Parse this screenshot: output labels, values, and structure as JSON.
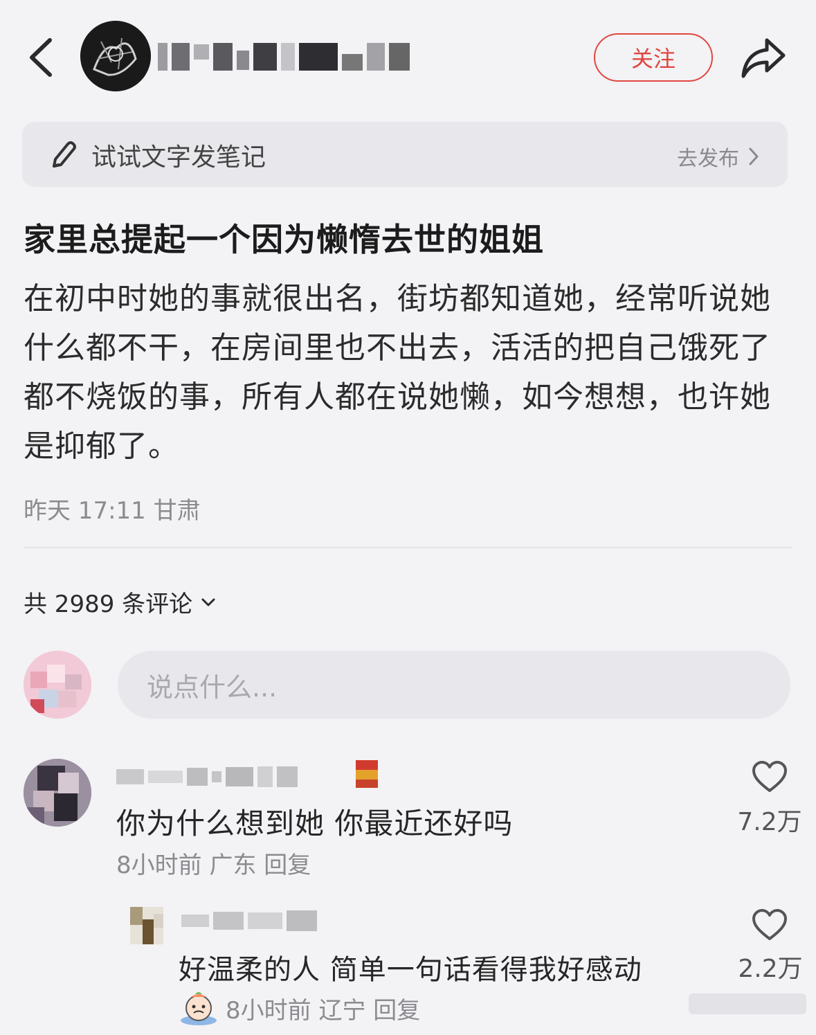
{
  "header": {
    "follow_label": "关注"
  },
  "draft_bar": {
    "label": "试试文字发笔记",
    "action": "去发布"
  },
  "post": {
    "title": "家里总提起一个因为懒惰去世的姐姐",
    "body": "在初中时她的事就很出名，街坊都知道她，经常听说她什么都不干，在房间里也不出去，活活的把自己饿死了都不烧饭的事，所有人都在说她懒，如今想想，也许她是抑郁了。",
    "meta": "昨天 17:11 甘肃"
  },
  "comments_header": {
    "count_label": "共 2989 条评论"
  },
  "composer": {
    "placeholder": "说点什么..."
  },
  "comments": [
    {
      "text": "你为什么想到她 你最近还好吗",
      "meta": "8小时前 广东 回复",
      "likes": "7.2万"
    }
  ],
  "replies": [
    {
      "text": "好温柔的人 简单一句话看得我好感动",
      "meta": "8小时前 辽宁 回复",
      "likes": "2.2万"
    }
  ],
  "colors": {
    "accent": "#e0463f",
    "background": "#f3f2f5",
    "muted_text": "#8b8b8f"
  },
  "icons": [
    "back-icon",
    "share-icon",
    "pencil-icon",
    "chevron-right-icon",
    "chevron-down-icon",
    "heart-icon",
    "sticker-icon"
  ]
}
